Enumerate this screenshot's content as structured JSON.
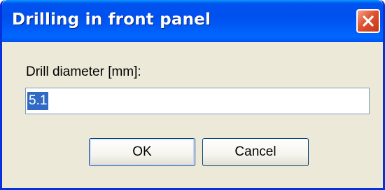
{
  "dialog": {
    "title": "Drilling in front panel",
    "close_icon": "close-icon",
    "field_label": "Drill diameter [mm]:",
    "field_value": "5.1",
    "ok_label": "OK",
    "cancel_label": "Cancel"
  },
  "colors": {
    "titlebar": "#0053ee",
    "close_button": "#e0532f",
    "dialog_background": "#ece9d8",
    "selection": "#316ac5"
  }
}
